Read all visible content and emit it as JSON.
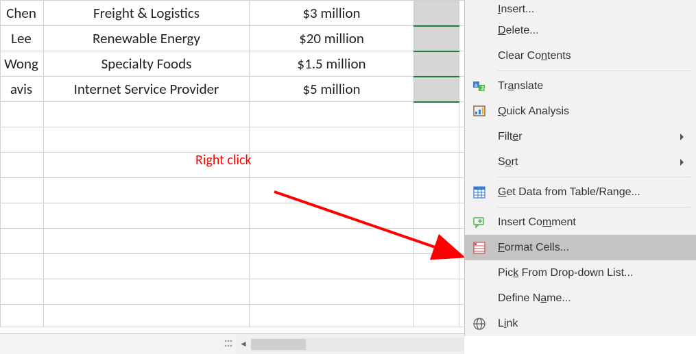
{
  "table": {
    "rows": [
      {
        "name": "Chen",
        "industry": "Freight & Logistics",
        "amount": "$3 million"
      },
      {
        "name": "Lee",
        "industry": "Renewable Energy",
        "amount": "$20 million"
      },
      {
        "name": "Wong",
        "industry": "Specialty Foods",
        "amount": "$1.5 million"
      },
      {
        "name": "avis",
        "industry": "Internet Service Provider",
        "amount": "$5 million"
      }
    ]
  },
  "annotation": {
    "label": "Right click"
  },
  "context_menu": {
    "insert": "Insert...",
    "delete": "Delete...",
    "clear_contents": "Clear Contents",
    "translate": "Translate",
    "quick_analysis": "Quick Analysis",
    "filter": "Filter",
    "sort": "Sort",
    "get_data": "Get Data from Table/Range...",
    "insert_comment": "Insert Comment",
    "format_cells": "Format Cells...",
    "pick_list": "Pick From Drop-down List...",
    "define_name": "Define Name...",
    "link": "Link"
  }
}
